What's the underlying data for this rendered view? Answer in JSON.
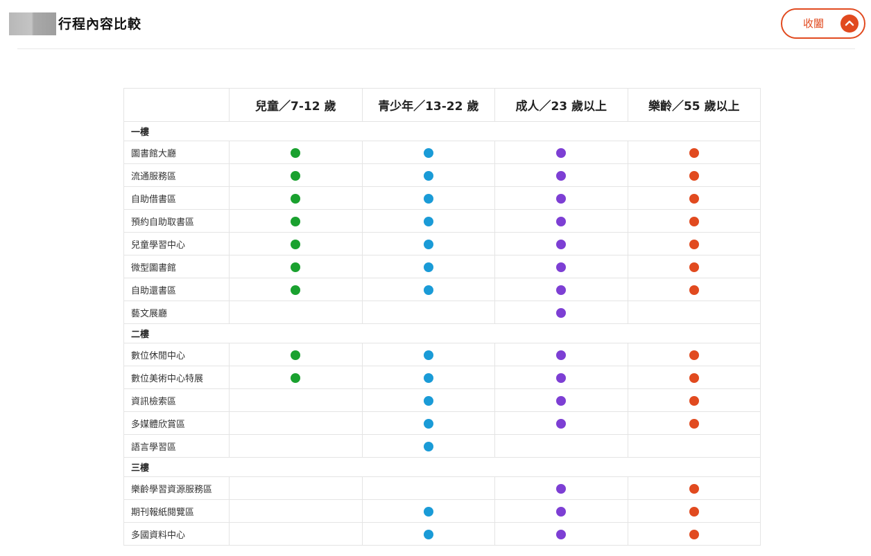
{
  "header": {
    "title": "行程內容比較",
    "collapse_label": "收闔"
  },
  "colors": {
    "accent": "#e14a1f",
    "children": "#1aa12f",
    "youth": "#1a9bd7",
    "adult": "#7d3fd4",
    "senior": "#e14a1f"
  },
  "columns": [
    {
      "key": "children",
      "label": "兒童／7-12 歲"
    },
    {
      "key": "youth",
      "label": "青少年／13-22 歲"
    },
    {
      "key": "adult",
      "label": "成人／23 歲以上"
    },
    {
      "key": "senior",
      "label": "樂齡／55 歲以上"
    }
  ],
  "sections": [
    {
      "name": "一樓",
      "rows": [
        {
          "label": "圖書館大廳",
          "children": true,
          "youth": true,
          "adult": true,
          "senior": true
        },
        {
          "label": "流通服務區",
          "children": true,
          "youth": true,
          "adult": true,
          "senior": true
        },
        {
          "label": "自助借書區",
          "children": true,
          "youth": true,
          "adult": true,
          "senior": true
        },
        {
          "label": "預約自助取書區",
          "children": true,
          "youth": true,
          "adult": true,
          "senior": true
        },
        {
          "label": "兒童學習中心",
          "children": true,
          "youth": true,
          "adult": true,
          "senior": true
        },
        {
          "label": "微型圖書館",
          "children": true,
          "youth": true,
          "adult": true,
          "senior": true
        },
        {
          "label": "自助還書區",
          "children": true,
          "youth": true,
          "adult": true,
          "senior": true
        },
        {
          "label": "藝文展廳",
          "children": false,
          "youth": false,
          "adult": true,
          "senior": false
        }
      ]
    },
    {
      "name": "二樓",
      "rows": [
        {
          "label": "數位休閒中心",
          "children": true,
          "youth": true,
          "adult": true,
          "senior": true
        },
        {
          "label": "數位美術中心特展",
          "children": true,
          "youth": true,
          "adult": true,
          "senior": true
        },
        {
          "label": "資訊檢索區",
          "children": false,
          "youth": true,
          "adult": true,
          "senior": true
        },
        {
          "label": "多媒體欣賞區",
          "children": false,
          "youth": true,
          "adult": true,
          "senior": true
        },
        {
          "label": "語言學習區",
          "children": false,
          "youth": true,
          "adult": false,
          "senior": false
        }
      ]
    },
    {
      "name": "三樓",
      "rows": [
        {
          "label": "樂齡學習資源服務區",
          "children": false,
          "youth": false,
          "adult": true,
          "senior": true
        },
        {
          "label": "期刊報紙閱覽區",
          "children": false,
          "youth": true,
          "adult": true,
          "senior": true
        },
        {
          "label": "多國資料中心",
          "children": false,
          "youth": true,
          "adult": true,
          "senior": true
        }
      ]
    }
  ]
}
